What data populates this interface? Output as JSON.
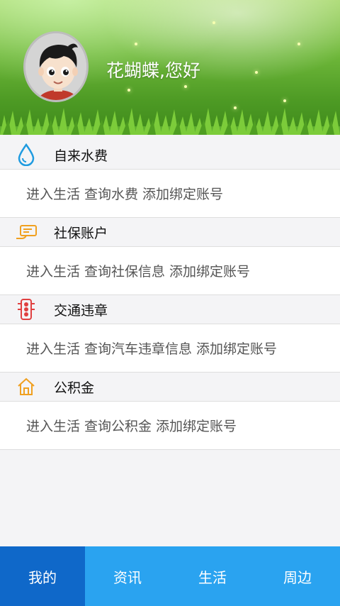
{
  "header": {
    "greeting": "花蝴蝶,您好"
  },
  "sections": [
    {
      "title": "自来水费",
      "icon": "water-drop-icon",
      "links": [
        "进入生活",
        "查询水费",
        "添加绑定账号"
      ]
    },
    {
      "title": "社保账户",
      "icon": "social-security-card-icon",
      "links": [
        "进入生活",
        "查询社保信息",
        "添加绑定账号"
      ]
    },
    {
      "title": "交通违章",
      "icon": "traffic-light-icon",
      "links": [
        "进入生活",
        "查询汽车违章信息",
        "添加绑定账号"
      ]
    },
    {
      "title": "公积金",
      "icon": "house-icon",
      "links": [
        "进入生活",
        "查询公积金",
        "添加绑定账号"
      ]
    }
  ],
  "tabbar": {
    "tabs": [
      {
        "label": "我的",
        "active": true
      },
      {
        "label": "资讯",
        "active": false
      },
      {
        "label": "生活",
        "active": false
      },
      {
        "label": "周边",
        "active": false
      }
    ]
  },
  "colors": {
    "tab_bar": "#2aa3f0",
    "tab_active": "#0f68c9",
    "water_icon": "#1f9be0",
    "traffic_icon": "#e04040",
    "accent_orange": "#f0a020"
  }
}
